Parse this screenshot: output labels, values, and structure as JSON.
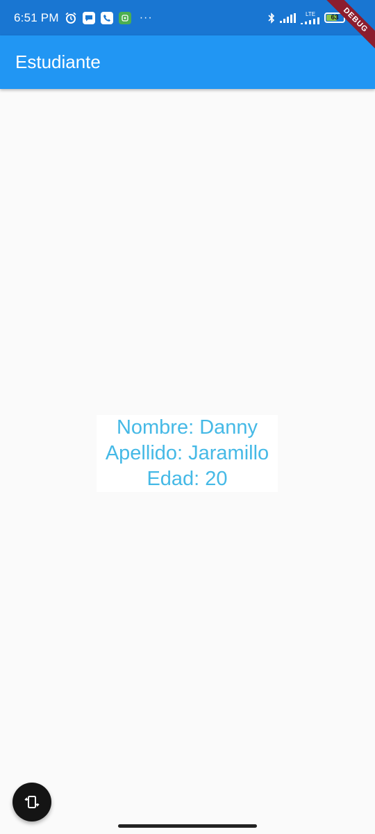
{
  "status_bar": {
    "time": "6:51 PM",
    "lte_label": "LTE",
    "battery_level": "63",
    "battery_fraction": 0.63,
    "icons": [
      "alarm-icon",
      "message-app-icon",
      "phone-app-icon",
      "green-app-icon",
      "more-dots-icon",
      "bluetooth-icon",
      "signal-icon",
      "lte-signal-icon",
      "battery-icon"
    ]
  },
  "debug_banner": "DEBUG",
  "app_bar": {
    "title": "Estudiante",
    "color": "#2196f3"
  },
  "student": {
    "name_line": "Nombre: Danny",
    "lastname_line": "Apellido: Jaramillo",
    "age_line": "Edad: 20",
    "text_color": "#45b9e6"
  },
  "fab": {
    "icon": "rotate-screen-icon",
    "color": "#141414"
  }
}
